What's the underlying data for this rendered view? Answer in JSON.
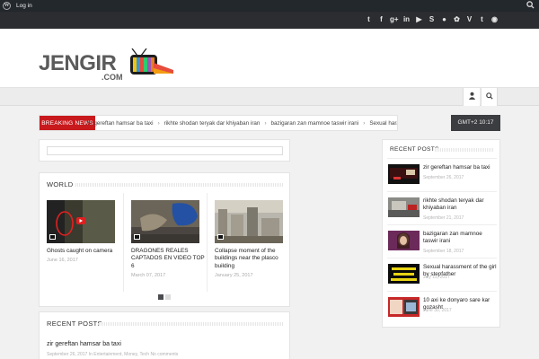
{
  "admin_bar": {
    "login": "Log in"
  },
  "social": {
    "icons": [
      "twitter-icon",
      "facebook-icon",
      "google-plus-icon",
      "linkedin-icon",
      "youtube-icon",
      "skype-icon",
      "flickr-icon",
      "stumbleupon-icon",
      "vimeo-icon",
      "tumblr-icon",
      "rss-icon"
    ],
    "glyphs": [
      "t",
      "f",
      "g+",
      "in",
      "▶",
      "S",
      "●",
      "✿",
      "V",
      "t",
      "◉"
    ]
  },
  "logo": {
    "word": "JENGIR",
    "com": ".COM"
  },
  "ticker": {
    "label": "BREAKING NEWS",
    "items": [
      "zir gereftan hamsar ba taxi",
      "rikhte shodan teryak dar khiyaban iran",
      "bazigaran zan mamnoe taswir irani",
      "Sexual harassment of the girl by stepfather"
    ]
  },
  "clock": "GMT+2 10:17",
  "world": {
    "title": "WORLD",
    "items": [
      {
        "title": "Ghosts caught on camera",
        "date": "June 16, 2017"
      },
      {
        "title": "DRAGONES REALES CAPTADOS EN VIDEO TOP 6",
        "date": "March 07, 2017"
      },
      {
        "title": "Collapse moment of the buildings near the plasco building",
        "date": "January 25, 2017"
      }
    ]
  },
  "recent_left": {
    "title": "RECENT POSTS",
    "post_title": "zir gereftan hamsar ba taxi",
    "post_meta": "September 26, 2017   In Entertainment, Money, Tech   No comments"
  },
  "recent": {
    "title": "RECENT POSTS",
    "items": [
      {
        "title": "zir gereftan hamsar ba taxi",
        "date": "September 26, 2017"
      },
      {
        "title": "rikhte shodan teryak dar khiyaban iran",
        "date": "September 21, 2017"
      },
      {
        "title": "bazigaran zan mamnoe taswir irani",
        "date": "September 18, 2017"
      },
      {
        "title": "Sexual harassment of the girl by stepfather",
        "date": "July 19, 2017"
      },
      {
        "title": "10 axi ke donyaro sare kar gozasht",
        "date": "June 30, 2017"
      }
    ]
  }
}
